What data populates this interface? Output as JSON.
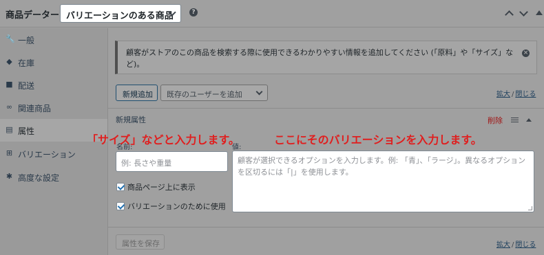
{
  "header": {
    "title": "商品データー",
    "product_type": "バリエーションのある商品",
    "help_icon": "?"
  },
  "sidebar": {
    "items": [
      {
        "label": "一般",
        "icon": "wrench-icon",
        "glyph": "🔧"
      },
      {
        "label": "在庫",
        "icon": "tag-icon",
        "glyph": "◆"
      },
      {
        "label": "配送",
        "icon": "truck-icon",
        "glyph": "■"
      },
      {
        "label": "関連商品",
        "icon": "link-icon",
        "glyph": "∞"
      },
      {
        "label": "属性",
        "icon": "table-icon",
        "glyph": "▤"
      },
      {
        "label": "バリエーション",
        "icon": "grid-icon",
        "glyph": "⊞"
      },
      {
        "label": "高度な設定",
        "icon": "gear-icon",
        "glyph": "✱"
      }
    ]
  },
  "notice": {
    "text": "顧客がストアのこの商品を検索する際に使用できるわかりやすい情報を追加してください (「原料」や「サイズ」など)。"
  },
  "toolbar": {
    "add_new_label": "新規追加",
    "existing_placeholder": "既存のユーザーを追加",
    "expand_label": "拡大",
    "separator": "/",
    "close_label": "閉じる"
  },
  "attribute": {
    "title": "新規属性",
    "remove_label": "削除",
    "name_label": "名前:",
    "values_label": "値:",
    "name_placeholder": "例: 長さや重量",
    "values_placeholder": "顧客が選択できるオプションを入力します。例: 「青」、「ラージ」。異なるオプションを区切るには「|」を使用します。",
    "visible_label": "商品ページ上に表示",
    "variation_label": "バリエーションのために使用"
  },
  "annotations": {
    "left": "「サイズ」などと入力します。",
    "right": "ここにそのバリエーションを入力します。"
  },
  "footer": {
    "save_label": "属性を保存"
  },
  "colors": {
    "annotation": "#e01e1e",
    "remove": "#a01515",
    "link": "#1c3e5c"
  }
}
